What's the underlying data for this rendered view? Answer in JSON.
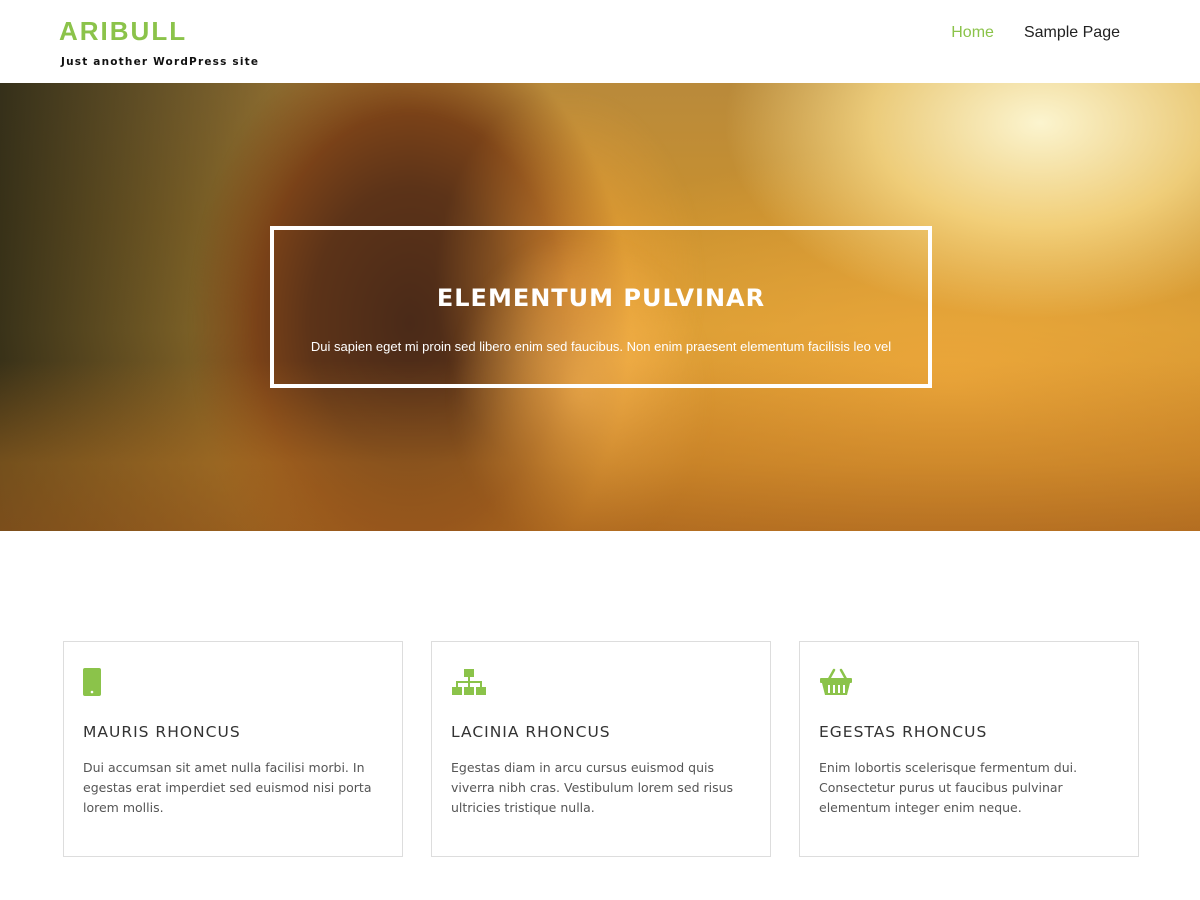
{
  "header": {
    "site_title": "ARIBULL",
    "tagline": "Just another WordPress site",
    "nav": [
      {
        "label": "Home",
        "active": true
      },
      {
        "label": "Sample Page",
        "active": false
      }
    ]
  },
  "hero": {
    "title": "ELEMENTUM PULVINAR",
    "text": "Dui sapien eget mi proin sed libero enim sed faucibus. Non enim praesent elementum facilisis leo vel"
  },
  "features": [
    {
      "icon": "mobile-icon",
      "title": "MAURIS RHONCUS",
      "text": "Dui accumsan sit amet nulla facilisi morbi. In egestas erat imperdiet sed euismod nisi porta lorem mollis."
    },
    {
      "icon": "sitemap-icon",
      "title": "LACINIA RHONCUS",
      "text": "Egestas diam in arcu cursus euismod quis viverra nibh cras. Vestibulum lorem sed risus ultricies tristique nulla."
    },
    {
      "icon": "shopping-basket-icon",
      "title": "EGESTAS RHONCUS",
      "text": "Enim lobortis scelerisque fermentum dui. Consectetur purus ut faucibus pulvinar elementum integer enim neque."
    }
  ],
  "colors": {
    "accent": "#8bc34a",
    "text": "#333333",
    "border": "#dddddd"
  }
}
